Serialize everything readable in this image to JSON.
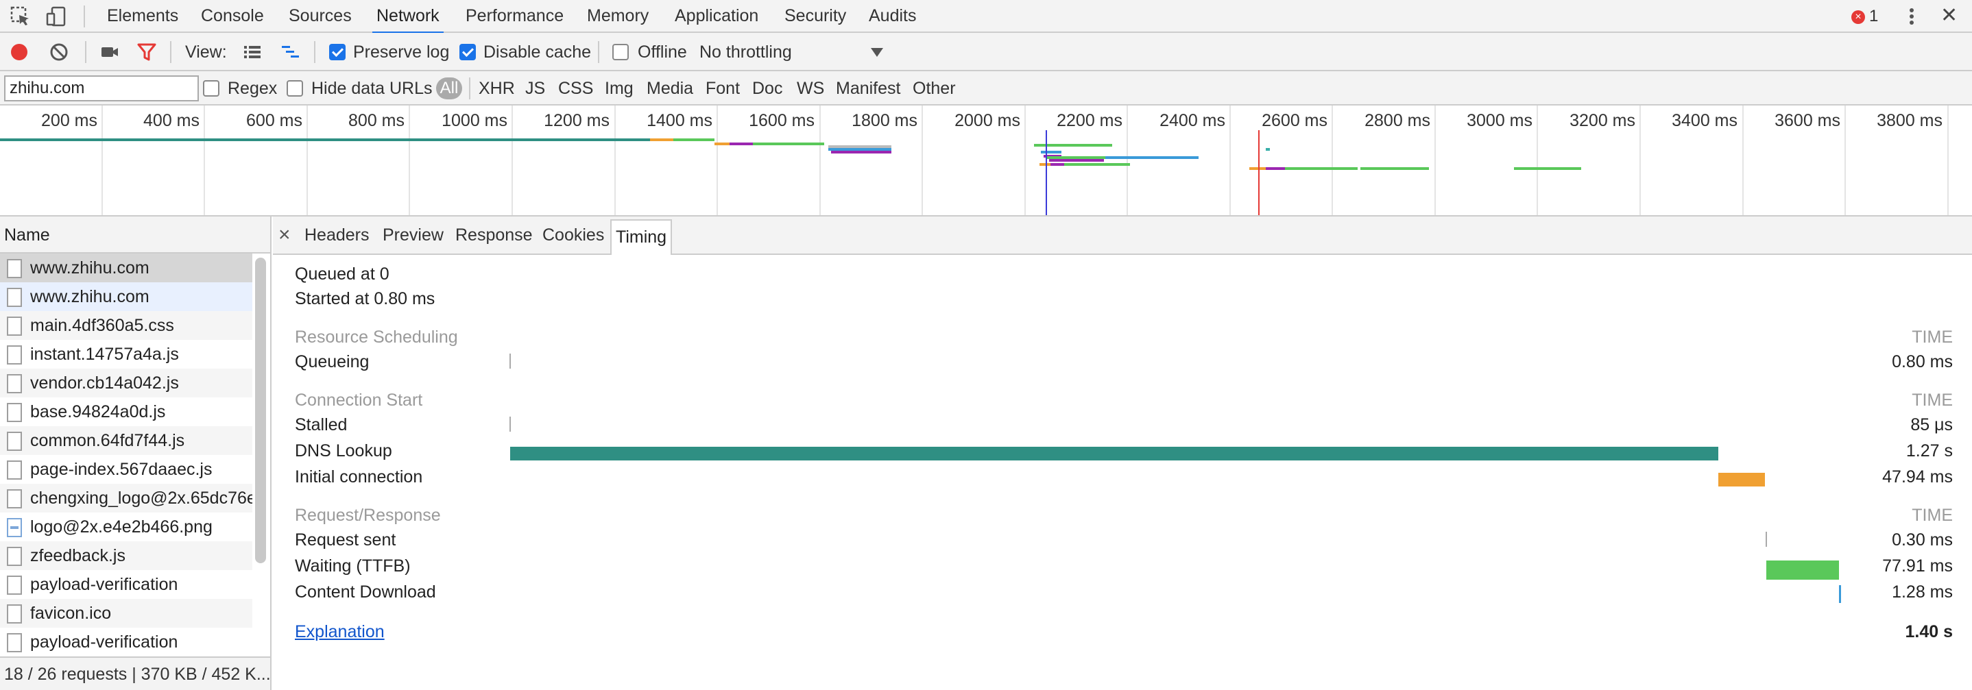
{
  "tabbar": {
    "tabs": [
      {
        "name": "elements",
        "label": "Elements"
      },
      {
        "name": "console",
        "label": "Console"
      },
      {
        "name": "sources",
        "label": "Sources"
      },
      {
        "name": "network",
        "label": "Network"
      },
      {
        "name": "performance",
        "label": "Performance"
      },
      {
        "name": "memory",
        "label": "Memory"
      },
      {
        "name": "application",
        "label": "Application"
      },
      {
        "name": "security",
        "label": "Security"
      },
      {
        "name": "audits",
        "label": "Audits"
      }
    ],
    "active_tab": "network",
    "error_count": "1",
    "error_glyph": "×",
    "close_glyph": "✕"
  },
  "toolbar1": {
    "view_label": "View:",
    "preserve_log_label": "Preserve log",
    "preserve_log_checked": true,
    "disable_cache_label": "Disable cache",
    "disable_cache_checked": true,
    "offline_label": "Offline",
    "offline_checked": false,
    "throttling_value": "No throttling",
    "record_color": "#e53935",
    "filter_color": "#e53935"
  },
  "toolbar2": {
    "filter_value": "zhihu.com",
    "regex_label": "Regex",
    "hide_data_urls_label": "Hide data URLs",
    "all_label": "All",
    "types": [
      "XHR",
      "JS",
      "CSS",
      "Img",
      "Media",
      "Font",
      "Doc",
      "WS",
      "Manifest",
      "Other"
    ]
  },
  "overview": {
    "ticks": [
      "200 ms",
      "400 ms",
      "600 ms",
      "800 ms",
      "1000 ms",
      "1200 ms",
      "1400 ms",
      "1600 ms",
      "1800 ms",
      "2000 ms",
      "2200 ms",
      "2400 ms",
      "2600 ms",
      "2800 ms",
      "3000 ms",
      "3200 ms",
      "3400 ms",
      "3600 ms",
      "3800 ms"
    ]
  },
  "requests": {
    "header": "Name",
    "items": [
      {
        "name": "www.zhihu.com",
        "type": "doc"
      },
      {
        "name": "www.zhihu.com",
        "type": "doc"
      },
      {
        "name": "main.4df360a5.css",
        "type": "doc"
      },
      {
        "name": "instant.14757a4a.js",
        "type": "doc"
      },
      {
        "name": "vendor.cb14a042.js",
        "type": "doc"
      },
      {
        "name": "base.94824a0d.js",
        "type": "doc"
      },
      {
        "name": "common.64fd7f44.js",
        "type": "doc"
      },
      {
        "name": "page-index.567daaec.js",
        "type": "doc"
      },
      {
        "name": "chengxing_logo@2x.65dc76e.",
        "type": "doc"
      },
      {
        "name": "logo@2x.e4e2b466.png",
        "type": "img"
      },
      {
        "name": "zfeedback.js",
        "type": "doc"
      },
      {
        "name": "payload-verification",
        "type": "doc"
      },
      {
        "name": "favicon.ico",
        "type": "doc"
      },
      {
        "name": "payload-verification",
        "type": "doc"
      }
    ],
    "status": "18 / 26 requests | 370 KB / 452 K..."
  },
  "detail": {
    "close_glyph": "×",
    "tabs": [
      "Headers",
      "Preview",
      "Response",
      "Cookies",
      "Timing"
    ],
    "active_tab": "Timing"
  },
  "timing": {
    "queued_at": "Queued at 0",
    "started_at": "Started at 0.80 ms",
    "time_header": "TIME",
    "sections": [
      {
        "title": "Resource Scheduling",
        "rows": [
          {
            "label": "Queueing",
            "value": "0.80 ms"
          }
        ]
      },
      {
        "title": "Connection Start",
        "rows": [
          {
            "label": "Stalled",
            "value": "85 μs"
          },
          {
            "label": "DNS Lookup",
            "value": "1.27 s"
          },
          {
            "label": "Initial connection",
            "value": "47.94 ms"
          }
        ]
      },
      {
        "title": "Request/Response",
        "rows": [
          {
            "label": "Request sent",
            "value": "0.30 ms"
          },
          {
            "label": "Waiting (TTFB)",
            "value": "77.91 ms"
          },
          {
            "label": "Content Download",
            "value": "1.28 ms"
          }
        ]
      }
    ],
    "explanation_label": "Explanation",
    "total": "1.40 s",
    "colors": {
      "dns": "#2f8f83",
      "connection": "#f0a032",
      "waiting": "#5ac85a",
      "download": "#3a9ad9"
    }
  }
}
